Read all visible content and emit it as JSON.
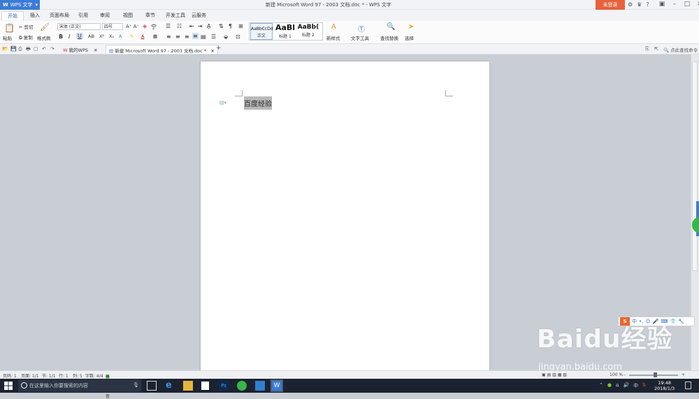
{
  "app": {
    "name": "WPS 文字",
    "login_label": "未登录"
  },
  "window": {
    "title": "新建 Microsoft Word 97 - 2003 文档.doc * - WPS 文字"
  },
  "menu_tabs": [
    {
      "label": "开始"
    },
    {
      "label": "插入"
    },
    {
      "label": "页面布局"
    },
    {
      "label": "引用"
    },
    {
      "label": "审阅"
    },
    {
      "label": "视图"
    },
    {
      "label": "章节"
    },
    {
      "label": "开发工具"
    },
    {
      "label": "云服务"
    }
  ],
  "ribbon": {
    "paste": "粘贴",
    "cut": "剪切",
    "copy": "复制",
    "format_painter": "格式刷",
    "font_name": "宋体 (正文)",
    "font_size": "四号",
    "styles": [
      {
        "sample": "AaBbCcDd",
        "label": "正文"
      },
      {
        "sample": "AaBl",
        "label": "标题 1"
      },
      {
        "sample": "AaBb(",
        "label": "标题 2"
      }
    ],
    "new_style": "新样式",
    "text_tools": "文字工具",
    "find_replace": "查找替换",
    "select": "选择"
  },
  "doc_tabs": [
    {
      "label": "我的WPS"
    },
    {
      "label": "新建 Microsoft Word 97 - 2003 文档.doc *"
    }
  ],
  "find_command": "点此查找命令",
  "document": {
    "selected_text": "百度经验"
  },
  "status": {
    "page_num": "页码: 1",
    "pages": "页面: 1/1",
    "section": "节: 1/1",
    "row": "行: 1",
    "col": "列: 5",
    "words": "字数: 4/4",
    "spellcheck": "拼写检查",
    "zoom": "100 %"
  },
  "taskbar": {
    "search_placeholder": "在这里输入你要搜索的内容",
    "ime": "中",
    "time": "19:48",
    "date": "2018/1/3"
  },
  "watermark": {
    "main": "Baidu经验",
    "sub": "jingyan.baidu.com"
  }
}
